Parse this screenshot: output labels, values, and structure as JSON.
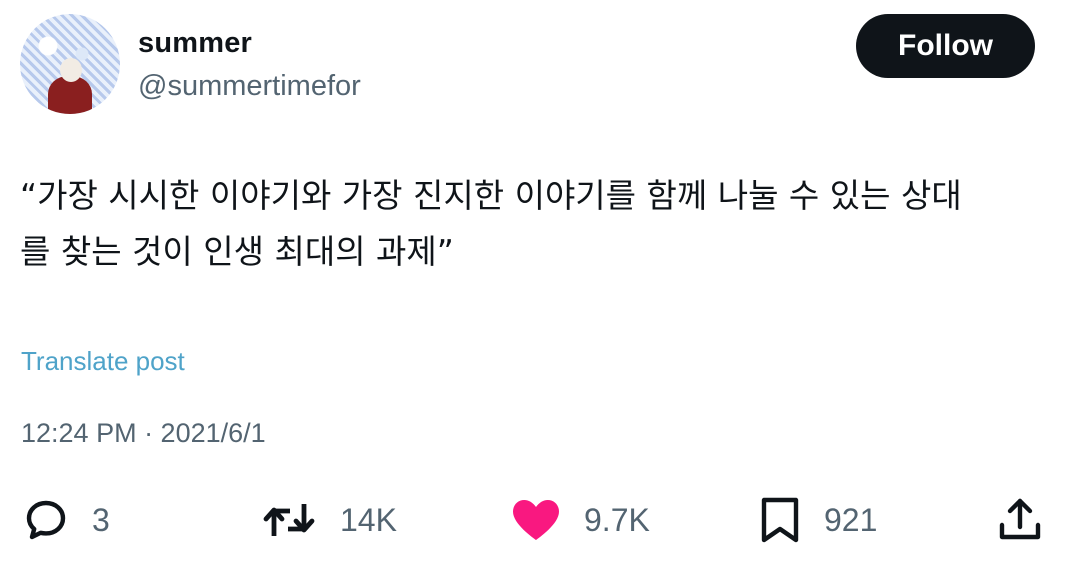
{
  "user": {
    "name": "summer",
    "handle": "@summertimefor"
  },
  "follow_label": "Follow",
  "post": {
    "text": "“가장 시시한 이야기와 가장 진지한 이야기를 함께 나눌 수 있는 상대\n를 찾는 것이 인생 최대의 과제”",
    "translate_label": "Translate post",
    "timestamp": "12:24 PM · 2021/6/1"
  },
  "actions": {
    "replies": "3",
    "reposts": "14K",
    "likes": "9.7K",
    "bookmarks": "921"
  },
  "icons": {
    "reply": "speech-bubble-icon",
    "repost": "repost-arrows-icon",
    "like": "heart-icon",
    "bookmark": "bookmark-icon",
    "share": "share-upload-icon"
  },
  "colors": {
    "like": "#f91880",
    "follow_bg": "#0f1419",
    "secondary_text": "#536471",
    "link": "#4fa3c9"
  }
}
